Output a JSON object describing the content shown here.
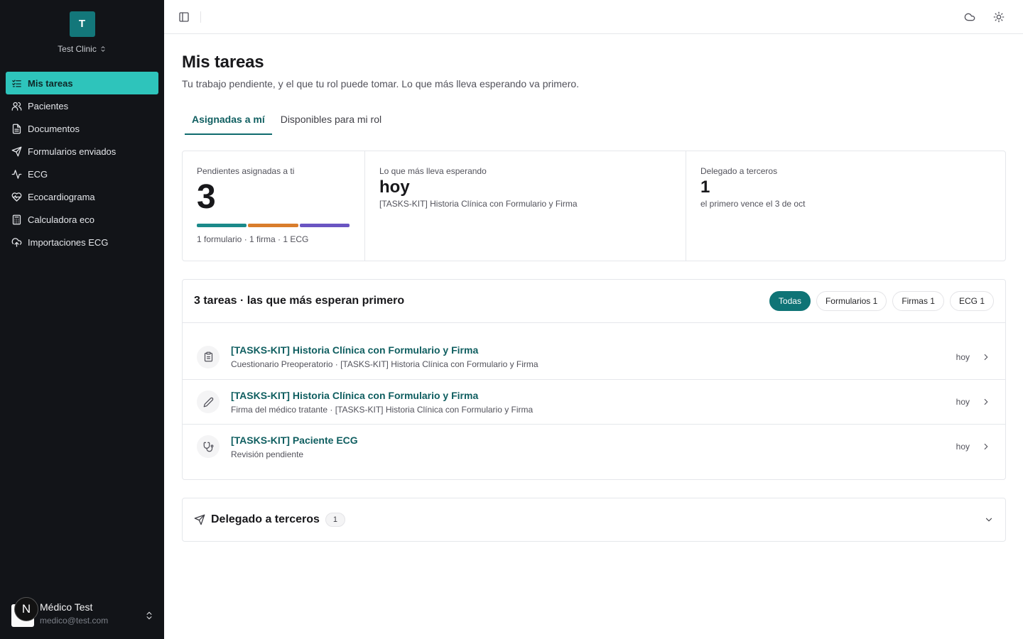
{
  "org": {
    "initial": "T",
    "name": "Test Clinic"
  },
  "nav": {
    "items": [
      {
        "label": "Mis tareas",
        "icon": "list-checks-icon",
        "active": true
      },
      {
        "label": "Pacientes",
        "icon": "users-icon"
      },
      {
        "label": "Documentos",
        "icon": "document-icon"
      },
      {
        "label": "Formularios enviados",
        "icon": "send-icon"
      },
      {
        "label": "ECG",
        "icon": "activity-icon"
      },
      {
        "label": "Ecocardiograma",
        "icon": "heart-pulse-icon"
      },
      {
        "label": "Calculadora eco",
        "icon": "calculator-icon"
      },
      {
        "label": "Importaciones ECG",
        "icon": "cloud-upload-icon"
      }
    ]
  },
  "user": {
    "badge": "N",
    "name": "Médico Test",
    "email": "medico@test.com"
  },
  "page": {
    "title": "Mis tareas",
    "subtitle": "Tu trabajo pendiente, y el que tu rol puede tomar. Lo que más lleva esperando va primero."
  },
  "tabs": [
    {
      "label": "Asignadas a mí",
      "active": true
    },
    {
      "label": "Disponibles para mi rol",
      "active": false
    }
  ],
  "stats": {
    "assigned": {
      "label": "Pendientes asignadas a ti",
      "value": "3",
      "breakdown": "1 formulario · 1 firma · 1 ECG",
      "segments": [
        {
          "kind": "formulario",
          "count": 1,
          "color": "#1b8a8a"
        },
        {
          "kind": "firma",
          "count": 1,
          "color": "#d97d2c"
        },
        {
          "kind": "ECG",
          "count": 1,
          "color": "#6a55c2"
        }
      ]
    },
    "oldest": {
      "label": "Lo que más lleva esperando",
      "value": "hoy",
      "detail": "[TASKS-KIT] Historia Clínica con Formulario y Firma"
    },
    "delegated": {
      "label": "Delegado a terceros",
      "value": "1",
      "detail": "el primero vence el 3 de oct"
    }
  },
  "tasks": {
    "heading": "3 tareas · las que más esperan primero",
    "filters": [
      {
        "label": "Todas",
        "active": true
      },
      {
        "label": "Formularios 1",
        "active": false
      },
      {
        "label": "Firmas 1",
        "active": false
      },
      {
        "label": "ECG 1",
        "active": false
      }
    ],
    "items": [
      {
        "icon": "clipboard-icon",
        "title": "[TASKS-KIT] Historia Clínica con Formulario y Firma",
        "subtitle": "Cuestionario Preoperatorio · [TASKS-KIT] Historia Clínica con Formulario y Firma",
        "when": "hoy"
      },
      {
        "icon": "pen-icon",
        "title": "[TASKS-KIT] Historia Clínica con Formulario y Firma",
        "subtitle": "Firma del médico tratante · [TASKS-KIT] Historia Clínica con Formulario y Firma",
        "when": "hoy"
      },
      {
        "icon": "stethoscope-icon",
        "title": "[TASKS-KIT] Paciente ECG",
        "subtitle": "Revisión pendiente",
        "when": "hoy"
      }
    ]
  },
  "delegated_section": {
    "title": "Delegado a terceros",
    "count": "1"
  },
  "colors": {
    "sidebar_bg": "#121418",
    "accent": "#0f7476",
    "active_nav": "#2ec4bb"
  }
}
